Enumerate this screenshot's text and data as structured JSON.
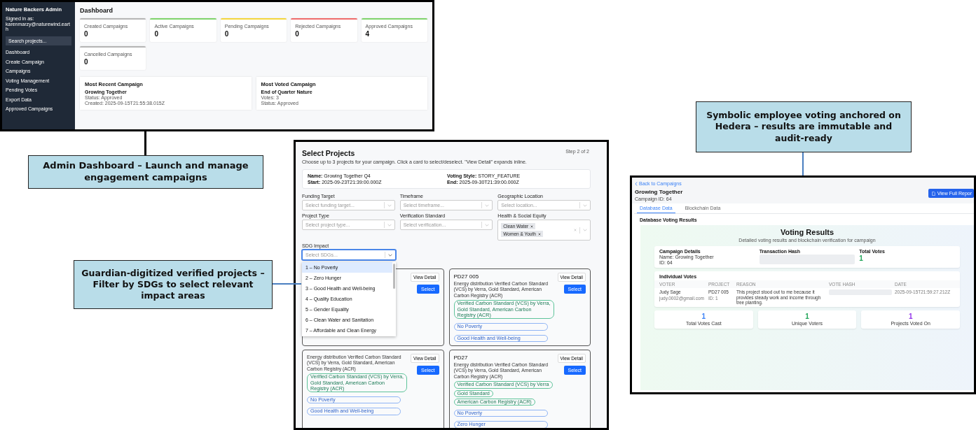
{
  "admin_dashboard": {
    "sidebar": {
      "title": "Nature Backers Admin",
      "signed_in_label": "Signed in as:",
      "email": "karenmarzy@naturewind.earth",
      "search_placeholder": "Search projects...",
      "items": [
        {
          "label": "Dashboard"
        },
        {
          "label": "Create Campaign"
        },
        {
          "label": "Campaigns"
        },
        {
          "label": "Voting Management"
        },
        {
          "label": "Pending Votes"
        },
        {
          "label": "Export Data"
        },
        {
          "label": "Approved Campaigns"
        }
      ]
    },
    "heading": "Dashboard",
    "stats": [
      {
        "label": "Created Campaigns",
        "value": "0",
        "color": "#b5b5b5"
      },
      {
        "label": "Active Campaigns",
        "value": "0",
        "color": "#7fd36b"
      },
      {
        "label": "Pending Campaigns",
        "value": "0",
        "color": "#f4d63c"
      },
      {
        "label": "Rejected Campaigns",
        "value": "0",
        "color": "#ef6b6b"
      },
      {
        "label": "Approved Campaigns",
        "value": "4",
        "color": "#7fd36b"
      },
      {
        "label": "Cancelled Campaigns",
        "value": "0",
        "color": "#b5b5b5"
      }
    ],
    "highlights": [
      {
        "title": "Most Recent Campaign",
        "name": "Growing Together",
        "lines": [
          "Status: Approved",
          "Created: 2025-09-15T21:55:38.015Z"
        ]
      },
      {
        "title": "Most Voted Campaign",
        "name": "End of Quarter Nature",
        "lines": [
          "Votes: 3",
          "Status: Approved"
        ]
      }
    ]
  },
  "callouts": [
    {
      "text": "Admin Dashboard – Launch and manage engagement campaigns"
    },
    {
      "text": "Guardian-digitized verified projects – Filter by SDGs to select relevant impact areas"
    },
    {
      "text": "Symbolic employee voting anchored on Hedera – results are immutable and audit-ready"
    }
  ],
  "select_projects": {
    "title": "Select Projects",
    "step": "Step 2 of 2",
    "subtitle": "Choose up to 3 projects for your campaign. Click a card to select/deselect. \"View Detail\" expands inline.",
    "summary": [
      {
        "label": "Name:",
        "value": "Growing Together Q4"
      },
      {
        "label": "Voting Style:",
        "value": "STORY_FEATURE"
      },
      {
        "label": "Start:",
        "value": "2025-09-23T21:39:00.000Z"
      },
      {
        "label": "End:",
        "value": "2025-09-30T21:39:00.000Z"
      }
    ],
    "filters": [
      {
        "label": "Funding Target",
        "placeholder": "Select funding target..."
      },
      {
        "label": "Timeframe",
        "placeholder": "Select timeframe..."
      },
      {
        "label": "Geographic Location",
        "placeholder": "Select location..."
      },
      {
        "label": "Project Type",
        "placeholder": "Select project type..."
      },
      {
        "label": "Verification Standard",
        "placeholder": "Select verification..."
      },
      {
        "label": "Health & Social Equity",
        "chips": [
          "Clean Water",
          "Women & Youth"
        ]
      }
    ],
    "sdg_filter": {
      "label": "SDG Impact",
      "placeholder": "Select SDGs...",
      "expanded": true,
      "options": [
        {
          "label": "1 – No Poverty",
          "selected": true
        },
        {
          "label": "2 – Zero Hunger",
          "selected": false
        },
        {
          "label": "3 – Good Health and Well-being",
          "selected": false
        },
        {
          "label": "4 – Quality Education",
          "selected": false
        },
        {
          "label": "5 – Gender Equality",
          "selected": false
        },
        {
          "label": "6 – Clean Water and Sanitation",
          "selected": false
        },
        {
          "label": "7 – Affordable and Clean Energy",
          "selected": false
        }
      ]
    },
    "projects": [
      {
        "view_detail_label": "View Detail",
        "select_label": "Select"
      },
      {
        "view_detail_label": "View Detail",
        "select_label": "Select",
        "name": "PD27 005",
        "description": "Energy distribution Verified Carbon Standard (VCS) by Verra, Gold Standard, American Carbon Registry (ACR)",
        "tags": [
          {
            "kind": "verification",
            "text": "Verified Carbon Standard (VCS) by Verra, Gold Standard, American Carbon Registry (ACR)"
          },
          {
            "kind": "sdg",
            "text": "No Poverty"
          },
          {
            "kind": "sdg",
            "text": "Good Health and Well-being"
          }
        ]
      },
      {
        "view_detail_label": "View Detail",
        "select_label": "Select",
        "description": "Energy distribution Verified Carbon Standard (VCS) by Verra, Gold Standard, American Carbon Registry (ACR)",
        "tags": [
          {
            "kind": "verification",
            "text": "Verified Carbon Standard (VCS) by Verra, Gold Standard, American Carbon Registry (ACR)"
          },
          {
            "kind": "sdg",
            "text": "No Poverty"
          },
          {
            "kind": "sdg",
            "text": "Good Health and Well-being"
          }
        ]
      },
      {
        "view_detail_label": "View Detail",
        "select_label": "Select",
        "name": "PD27",
        "description": "Energy distribution Verified Carbon Standard (VCS) by Verra, Gold Standard, American Carbon Registry (ACR)",
        "tags": [
          {
            "kind": "verification",
            "text": "Verified Carbon Standard (VCS) by Verra"
          },
          {
            "kind": "verification",
            "text": "Gold Standard"
          },
          {
            "kind": "verification",
            "text": "American Carbon Registry (ACR)"
          },
          {
            "kind": "sdg",
            "text": "No Poverty"
          },
          {
            "kind": "sdg",
            "text": "Zero Hunger"
          }
        ]
      }
    ]
  },
  "voting": {
    "back_link": "Back to Campaigns",
    "title": "Growing Together",
    "campaign_id": "Campaign ID: 64",
    "report_button": "View Full Repor",
    "tabs": [
      {
        "label": "Database Data",
        "selected": true
      },
      {
        "label": "Blockchain Data",
        "selected": false
      }
    ],
    "section_title": "Database Voting Results",
    "results_title": "Voting Results",
    "results_subtitle": "Detailed voting results and blockchain verification for campaign",
    "details": {
      "title": "Campaign Details",
      "name": "Name: Growing Together",
      "id": "ID: 64",
      "hash_title": "Transaction Hash",
      "total_title": "Total Votes",
      "total": "1"
    },
    "votes": {
      "title": "Individual Votes",
      "columns": [
        "VOTER",
        "PROJECT",
        "REASON",
        "VOTE HASH",
        "DATE"
      ],
      "rows": [
        {
          "voter": "Judy Sage",
          "email": "judy.0002@gmail.com",
          "project": "PD27 005",
          "project_id": "ID: 1",
          "reason": "This project stood out to me because it provides steady work and income through tree planting.",
          "date": "2025-09-15T21:59:27.212Z"
        }
      ]
    },
    "stats": [
      {
        "value": "1",
        "label": "Total Votes Cast",
        "color": "#3b82f6"
      },
      {
        "value": "1",
        "label": "Unique Voters",
        "color": "#22a55a"
      },
      {
        "value": "1",
        "label": "Projects Voted On",
        "color": "#9333ea"
      }
    ]
  }
}
